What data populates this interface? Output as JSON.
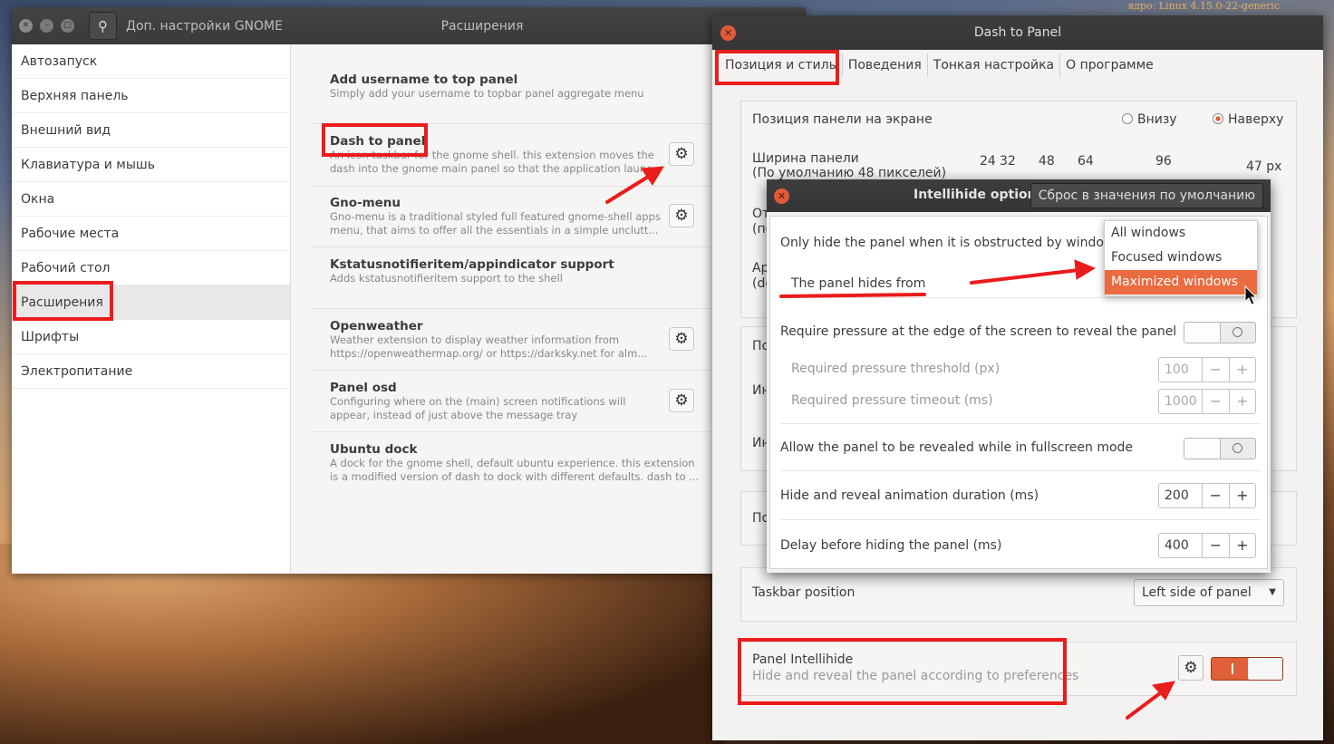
{
  "desktop": {
    "kernel_label": "ядро:",
    "kernel_value": "Linux 4.15.0-22-generic"
  },
  "tweaks": {
    "title": "Доп. настройки GNOME",
    "section_title": "Расширения",
    "sidebar": [
      {
        "label": "Автозапуск"
      },
      {
        "label": "Верхняя панель"
      },
      {
        "label": "Внешний вид"
      },
      {
        "label": "Клавиатура и мышь"
      },
      {
        "label": "Окна"
      },
      {
        "label": "Рабочие места"
      },
      {
        "label": "Рабочий стол"
      },
      {
        "label": "Расширения"
      },
      {
        "label": "Шрифты"
      },
      {
        "label": "Электропитание"
      }
    ],
    "extensions": [
      {
        "name": "Add username to top panel",
        "desc1": "Simply add your username to topbar panel aggregate menu",
        "desc2": ""
      },
      {
        "name": "Dash to panel",
        "desc1": "An icon taskbar for the gnome shell. this extension moves the",
        "desc2": "dash into the gnome main panel so that the application launc..."
      },
      {
        "name": "Gno-menu",
        "desc1": "Gno-menu is a traditional styled full featured gnome-shell apps",
        "desc2": "menu, that aims to offer all the essentials in a simple unclutt..."
      },
      {
        "name": "Kstatusnotifieritem/appindicator support",
        "desc1": "Adds kstatusnotifieritem support to the shell",
        "desc2": ""
      },
      {
        "name": "Openweather",
        "desc1": "Weather extension to display weather information from",
        "desc2": "https://openweathermap.org/ or https://darksky.net for alm..."
      },
      {
        "name": "Panel osd",
        "desc1": "Configuring where on the (main) screen notifications will",
        "desc2": "appear, instead of just above the message tray"
      },
      {
        "name": "Ubuntu dock",
        "desc1": "A dock for the gnome shell, default ubuntu experience. this extension",
        "desc2": "is a modified version of dash to dock with different defaults. dash to ..."
      }
    ]
  },
  "dtp": {
    "title": "Dash to Panel",
    "tabs": [
      "Позиция и стиль",
      "Поведения",
      "Тонкая настройка",
      "О программе"
    ],
    "position_label": "Позиция панели на экране",
    "pos_bottom": "Внизу",
    "pos_top": "Наверху",
    "width_label1": "Ширина панели",
    "width_label2": "(По умолчанию 48 пикселей)",
    "width_ticks": [
      "24",
      "32",
      "48",
      "64",
      "96"
    ],
    "width_value": "47 px",
    "trunc_labels": [
      "От",
      "(по",
      "Ар",
      "(de",
      "По",
      "Ин",
      "Ин",
      "По"
    ],
    "taskbar_position_label": "Taskbar position",
    "taskbar_position_value": "Left side of panel",
    "intellihide_title": "Panel Intellihide",
    "intellihide_desc": "Hide and reveal the panel according to preferences"
  },
  "dialog": {
    "title": "Intellihide options",
    "reset": "Сброс в значения по умолчанию",
    "only_hide": "Only hide the panel when it is obstructed by windows",
    "hides_from": "The panel hides from",
    "dropdown": [
      "All windows",
      "Focused windows",
      "Maximized windows"
    ],
    "require_pressure": "Require pressure at the edge of the screen  to reveal the panel",
    "pressure_threshold": "Required pressure threshold (px)",
    "pressure_threshold_value": "100",
    "pressure_timeout": "Required pressure timeout (ms)",
    "pressure_timeout_value": "1000",
    "fullscreen": "Allow the panel to be revealed while in fullscreen mode",
    "anim_duration": "Hide and reveal animation duration (ms)",
    "anim_duration_value": "200",
    "delay": "Delay before hiding the panel (ms)",
    "delay_value": "400",
    "minus": "−",
    "plus": "+"
  },
  "colors": {
    "accent": "#e96b3f",
    "highlight": "#ea1c1c",
    "titlebar": "#3a3a3a"
  }
}
